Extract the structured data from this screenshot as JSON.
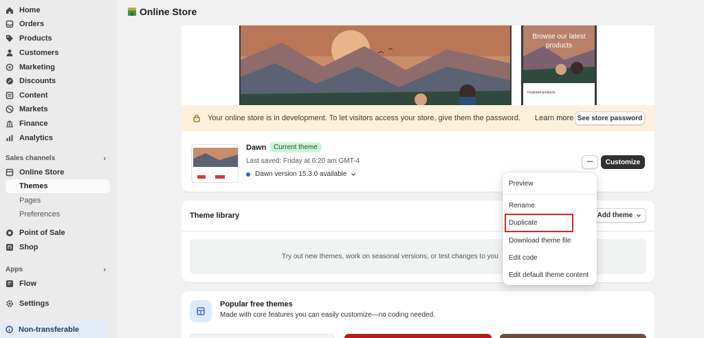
{
  "sidebar": {
    "main_items": [
      {
        "label": "Home",
        "icon": "home-icon"
      },
      {
        "label": "Orders",
        "icon": "orders-icon"
      },
      {
        "label": "Products",
        "icon": "tag-icon"
      },
      {
        "label": "Customers",
        "icon": "person-icon"
      },
      {
        "label": "Marketing",
        "icon": "target-icon"
      },
      {
        "label": "Discounts",
        "icon": "discount-icon"
      },
      {
        "label": "Content",
        "icon": "content-icon"
      },
      {
        "label": "Markets",
        "icon": "globe-icon"
      },
      {
        "label": "Finance",
        "icon": "bank-icon"
      },
      {
        "label": "Analytics",
        "icon": "chart-icon"
      }
    ],
    "sales_channels_label": "Sales channels",
    "online_store": "Online Store",
    "themes": "Themes",
    "pages": "Pages",
    "preferences": "Preferences",
    "point_of_sale": "Point of Sale",
    "shop": "Shop",
    "apps_label": "Apps",
    "flow": "Flow",
    "settings": "Settings",
    "non_transferable": "Non-transferable"
  },
  "header": {
    "title": "Online Store"
  },
  "preview": {
    "mobile_title": "Browse our latest products",
    "featured": "Featured products"
  },
  "banner": {
    "text": "Your online store is in development. To let visitors access your store, give them the password.",
    "learn_more": "Learn more",
    "see_password": "See store password"
  },
  "theme": {
    "name": "Dawn",
    "badge": "Current theme",
    "last_saved": "Last saved: Friday at 6:20 am GMT-4",
    "version": "Dawn version 15.3.0 available",
    "customize": "Customize",
    "more": "···"
  },
  "library": {
    "title": "Theme library",
    "add_theme": "Add theme",
    "empty_text": "Try out new themes, work on seasonal versions, or test changes to you"
  },
  "popular": {
    "title": "Popular free themes",
    "desc": "Made with core features you can easily customize—no coding needed."
  },
  "menu": {
    "items": [
      "Preview",
      "Rename",
      "Duplicate",
      "Download theme file",
      "Edit code",
      "Edit default theme content"
    ]
  },
  "colors": {
    "accent": "#303030",
    "highlight": "#e0202a",
    "badge_bg": "#cdf5d6",
    "banner_bg": "#fdf1dc"
  }
}
